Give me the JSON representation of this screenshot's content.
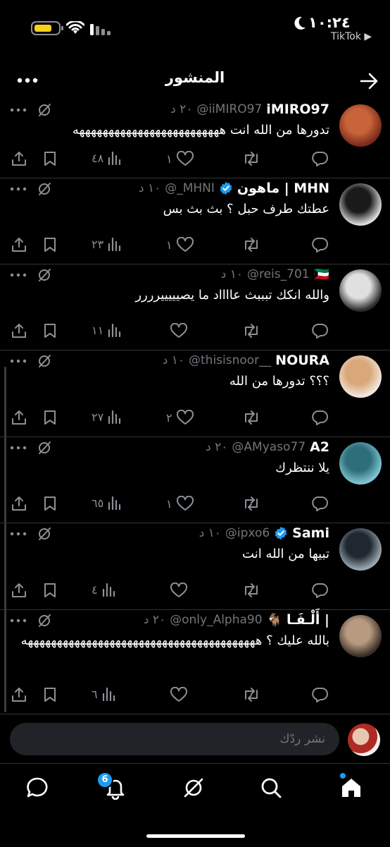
{
  "status_bar": {
    "time": "١٠:٢٤",
    "back_app": "TikTok ▶"
  },
  "header": {
    "title": "المنشور"
  },
  "posts": [
    {
      "name": "iMIRO97",
      "handle": "@iiMIRO97",
      "time": "٢٠ د",
      "verified": false,
      "flag": "",
      "text": "تدورها من الله انت هههههههههههههههههههههههههه",
      "views": "٤٨",
      "likes": "١",
      "reposts": "",
      "avatar_colors": [
        "#7a2a1c",
        "#c9643a"
      ]
    },
    {
      "name": "ماهون | MHN",
      "handle": "@_MHNI",
      "time": "١٠ د",
      "verified": true,
      "flag": "",
      "text": "عطتك طرف حبل ؟ بث بث بس",
      "views": "٢٣",
      "likes": "١",
      "reposts": "",
      "avatar_colors": [
        "#d9d9d9",
        "#1a1a1a"
      ]
    },
    {
      "name": "",
      "handle": "@reis_701",
      "time": "١٠ د",
      "verified": false,
      "flag": "🇰🇼",
      "text": "والله انكك تبببث عااااد ما يصيييييرررر",
      "views": "١١",
      "likes": "",
      "reposts": "",
      "avatar_colors": [
        "#2b2b2b",
        "#e0e0e0"
      ]
    },
    {
      "name": "NOURA",
      "handle": "@thisisnoor__",
      "time": "١٠ د",
      "verified": false,
      "flag": "",
      "text": "؟؟؟ تدورها من الله",
      "views": "٢٧",
      "likes": "٢",
      "reposts": "",
      "avatar_colors": [
        "#f2e6dc",
        "#d8a77a"
      ]
    },
    {
      "name": "A2",
      "handle": "@AMyaso77",
      "time": "٢٠ د",
      "verified": false,
      "flag": "",
      "text": "يلا ننتظرك",
      "views": "٦٥",
      "likes": "١",
      "reposts": "",
      "avatar_colors": [
        "#7fc3cf",
        "#2e6d7a"
      ]
    },
    {
      "name": "Sami",
      "handle": "@ipxo6",
      "time": "١٠ د",
      "verified": true,
      "flag": "",
      "text": "تبيها من الله انت",
      "views": "٤",
      "likes": "",
      "reposts": "",
      "avatar_colors": [
        "#9aa6ae",
        "#1f2830"
      ]
    },
    {
      "name": "أَلْـفَـا |",
      "handle": "@only_Alpha90",
      "time": "٢٠ د",
      "verified": false,
      "flag": "🐐",
      "text": "بالله عليك ؟ ههههههههههههههههههههههههههههههههههههههههه",
      "views": "٦",
      "likes": "",
      "reposts": "",
      "avatar_colors": [
        "#3a2f28",
        "#b89a80"
      ]
    }
  ],
  "reply": {
    "placeholder": "نشر ردّك"
  },
  "nav": {
    "notifications_count": "6",
    "items": [
      "home-icon",
      "search-icon",
      "grok-icon",
      "bell-icon",
      "messages-icon"
    ]
  },
  "colors": {
    "accent": "#1d9bf0",
    "background": "#000000",
    "muted": "#71767b",
    "battery": "#f7d11b"
  }
}
